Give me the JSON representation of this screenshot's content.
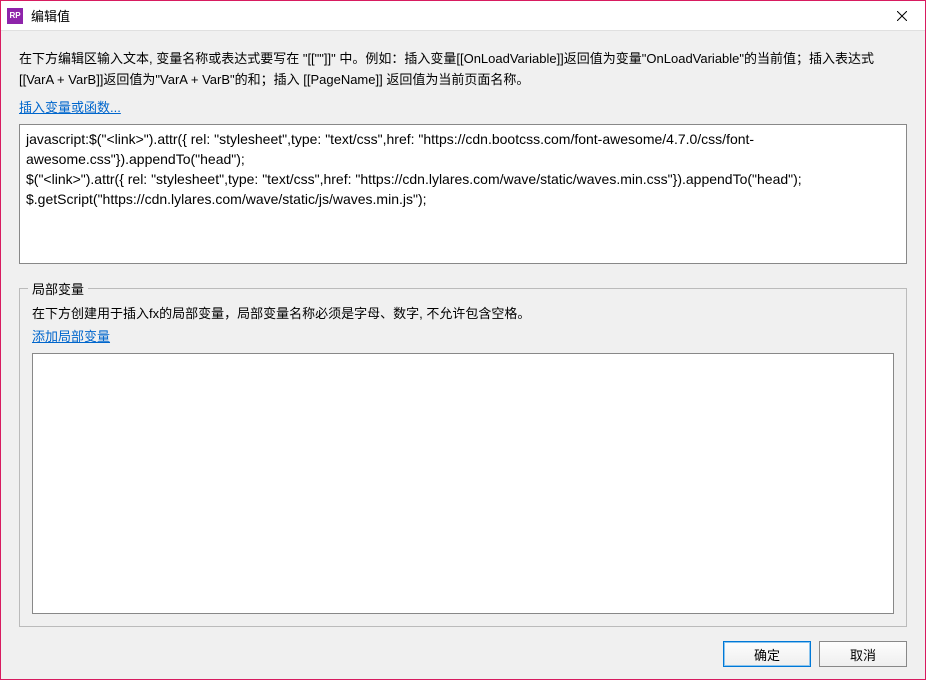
{
  "titlebar": {
    "app_icon_text": "RP",
    "title": "编辑值"
  },
  "instruction": "在下方编辑区输入文本, 变量名称或表达式要写在 \"[[\"\"]]\" 中。例如：插入变量[[OnLoadVariable]]返回值为变量\"OnLoadVariable\"的当前值；插入表达式[[VarA + VarB]]返回值为\"VarA + VarB\"的和；插入 [[PageName]] 返回值为当前页面名称。",
  "insert_link_label": "插入变量或函数...",
  "code_value": "javascript:$(\"<link>\").attr({ rel: \"stylesheet\",type: \"text/css\",href: \"https://cdn.bootcss.com/font-awesome/4.7.0/css/font-awesome.css\"}).appendTo(\"head\");\n$(\"<link>\").attr({ rel: \"stylesheet\",type: \"text/css\",href: \"https://cdn.lylares.com/wave/static/waves.min.css\"}).appendTo(\"head\");\n$.getScript(\"https://cdn.lylares.com/wave/static/js/waves.min.js\");",
  "local_vars": {
    "legend": "局部变量",
    "instruction": "在下方创建用于插入fx的局部变量，局部变量名称必须是字母、数字, 不允许包含空格。",
    "add_link_label": "添加局部变量"
  },
  "buttons": {
    "ok": "确定",
    "cancel": "取消"
  }
}
